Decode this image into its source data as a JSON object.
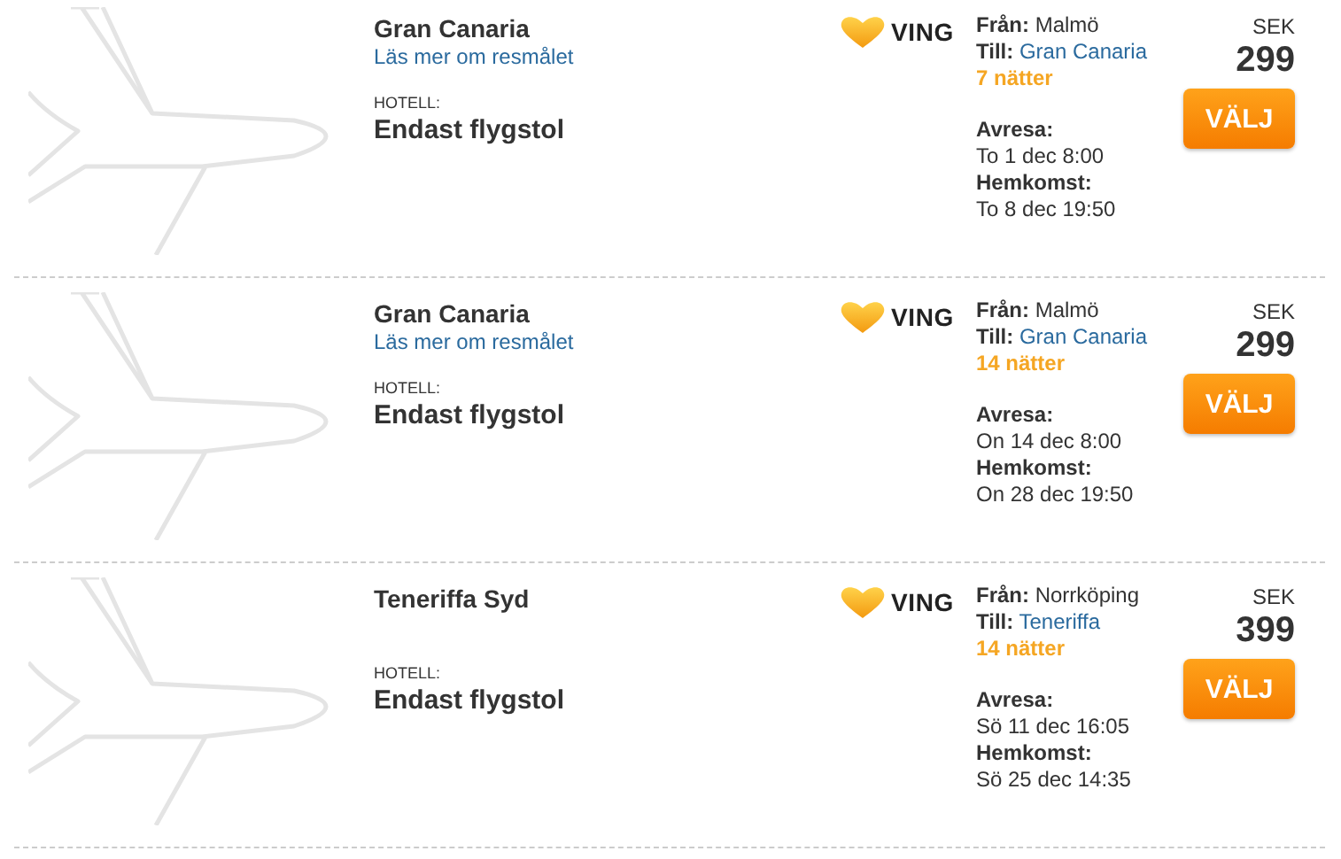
{
  "offers": [
    {
      "destination": "Gran Canaria",
      "link": "Läs mer om resmålet",
      "hotel_label": "HOTELL:",
      "hotel": "Endast flygstol",
      "brand": "VING",
      "from_label": "Från:",
      "from": "Malmö",
      "to_label": "Till:",
      "to": "Gran Canaria",
      "nights": "7 nätter",
      "depart_label": "Avresa:",
      "depart": "To 1 dec 8:00",
      "return_label": "Hemkomst:",
      "return": "To 8 dec 19:50",
      "currency": "SEK",
      "price": "299",
      "button": "VÄLJ"
    },
    {
      "destination": "Gran Canaria",
      "link": "Läs mer om resmålet",
      "hotel_label": "HOTELL:",
      "hotel": "Endast flygstol",
      "brand": "VING",
      "from_label": "Från:",
      "from": "Malmö",
      "to_label": "Till:",
      "to": "Gran Canaria",
      "nights": "14 nätter",
      "depart_label": "Avresa:",
      "depart": "On 14 dec 8:00",
      "return_label": "Hemkomst:",
      "return": "On 28 dec 19:50",
      "currency": "SEK",
      "price": "299",
      "button": "VÄLJ"
    },
    {
      "destination": "Teneriffa Syd",
      "hotel_label": "HOTELL:",
      "hotel": "Endast flygstol",
      "brand": "VING",
      "from_label": "Från:",
      "from": "Norrköping",
      "to_label": "Till:",
      "to": "Teneriffa",
      "nights": "14 nätter",
      "depart_label": "Avresa:",
      "depart": "Sö 11 dec 16:05",
      "return_label": "Hemkomst:",
      "return": "Sö 25 dec 14:35",
      "currency": "SEK",
      "price": "399",
      "button": "VÄLJ"
    }
  ]
}
